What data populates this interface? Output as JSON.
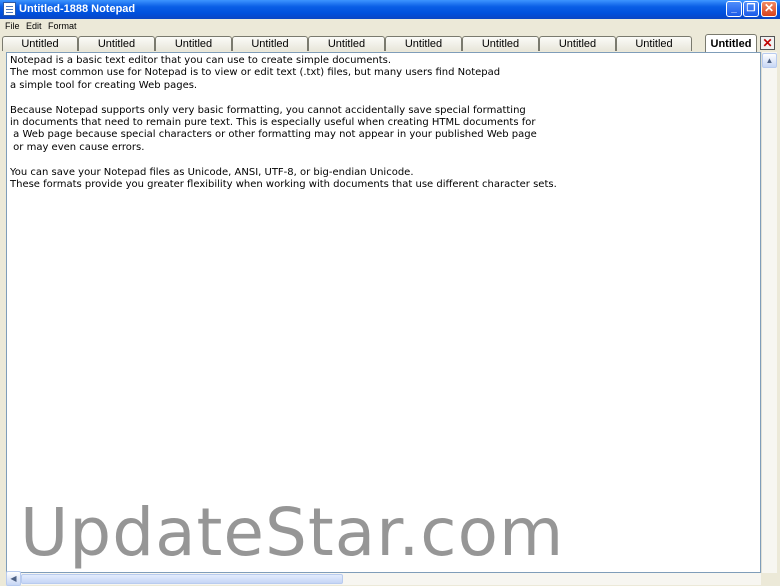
{
  "window": {
    "title": "Untitled-1888 Notepad",
    "icon": "notepad-icon",
    "buttons": [
      "_",
      "❐",
      "✕"
    ]
  },
  "menu": [
    "File",
    "Edit",
    "Format"
  ],
  "tabs": [
    {
      "label": "Untitled"
    },
    {
      "label": "Untitled"
    },
    {
      "label": "Untitled"
    },
    {
      "label": "Untitled"
    },
    {
      "label": "Untitled"
    },
    {
      "label": "Untitled"
    },
    {
      "label": "Untitled"
    },
    {
      "label": "Untitled"
    },
    {
      "label": "Untitled"
    },
    {
      "label": "Untitled",
      "active": true
    }
  ],
  "tab_close": "✕",
  "editor": {
    "text": "Notepad is a basic text editor that you can use to create simple documents.\nThe most common use for Notepad is to view or edit text (.txt) files, but many users find Notepad\na simple tool for creating Web pages.\n\nBecause Notepad supports only very basic formatting, you cannot accidentally save special formatting\nin documents that need to remain pure text. This is especially useful when creating HTML documents for\n a Web page because special characters or other formatting may not appear in your published Web page\n or may even cause errors.\n\nYou can save your Notepad files as Unicode, ANSI, UTF-8, or big-endian Unicode.\nThese formats provide you greater flexibility when working with documents that use different character sets."
  },
  "scrollbar": {
    "up": "▲",
    "left": "◀"
  },
  "watermark": "UpdateStar.com",
  "colors": {
    "titlebar": "#0a5fe6",
    "chrome": "#ece9d8",
    "close": "#d8421c"
  }
}
